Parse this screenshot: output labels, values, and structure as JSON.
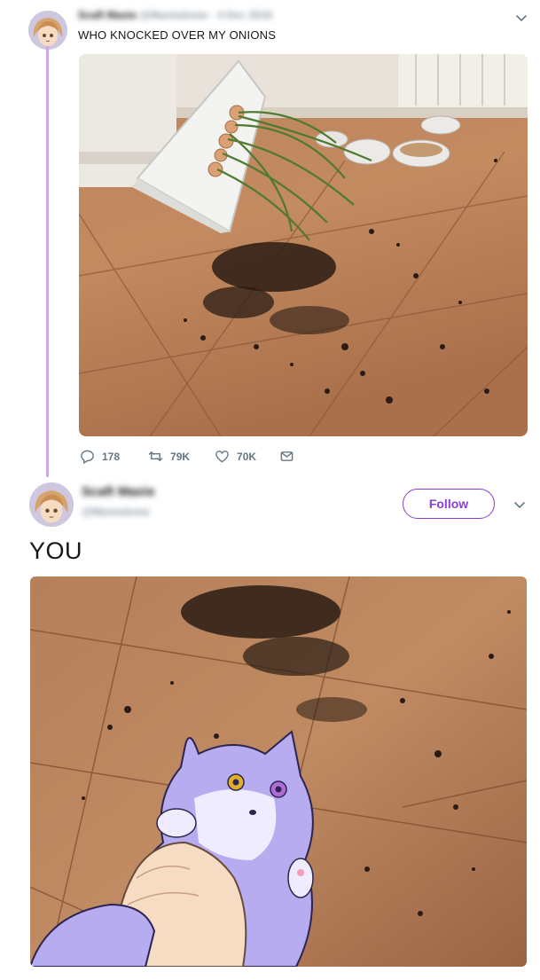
{
  "tweet1": {
    "author_name": "Scaft Maxie",
    "author_handle": "@Maxiedome",
    "date": "· 4 Dec 2016",
    "text": "WHO KNOCKED OVER MY ONIONS",
    "stats": {
      "replies": "178",
      "retweets": "79K",
      "likes": "70K"
    }
  },
  "tweet2": {
    "author_name": "Scaft Maxie",
    "author_handle": "@Maxiedome",
    "follow_label": "Follow",
    "text": "YOU"
  },
  "colors": {
    "accent": "#8a3cd6",
    "thread_line": "#c9a8ee",
    "muted": "#657786"
  },
  "icons": [
    "avatar",
    "chevron-down-icon",
    "reply-icon",
    "retweet-icon",
    "like-icon",
    "message-icon"
  ]
}
